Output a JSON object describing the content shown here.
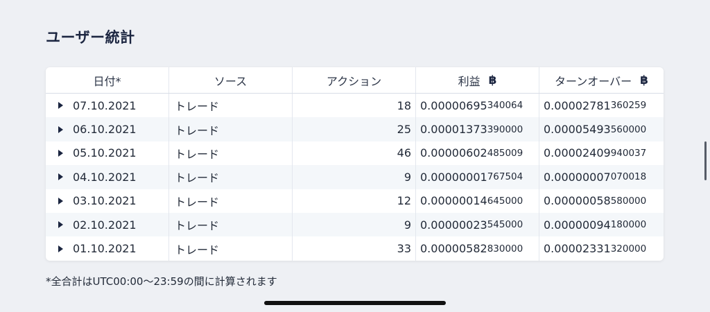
{
  "page_title": "ユーザー統計",
  "table": {
    "headers": {
      "date": "日付*",
      "source": "ソース",
      "action": "アクション",
      "profit": "利益",
      "turnover": "ターンオーバー"
    },
    "currency_symbol": "฿",
    "rows": [
      {
        "date": "07.10.2021",
        "source": "トレード",
        "action": "18",
        "profit_main": "0.00000695",
        "profit_tail": "340064",
        "turnover_main": "0.00002781",
        "turnover_tail": "360259"
      },
      {
        "date": "06.10.2021",
        "source": "トレード",
        "action": "25",
        "profit_main": "0.00001373",
        "profit_tail": "390000",
        "turnover_main": "0.00005493",
        "turnover_tail": "560000"
      },
      {
        "date": "05.10.2021",
        "source": "トレード",
        "action": "46",
        "profit_main": "0.00000602",
        "profit_tail": "485009",
        "turnover_main": "0.00002409",
        "turnover_tail": "940037"
      },
      {
        "date": "04.10.2021",
        "source": "トレード",
        "action": "9",
        "profit_main": "0.00000001",
        "profit_tail": "767504",
        "turnover_main": "0.00000007",
        "turnover_tail": "070018"
      },
      {
        "date": "03.10.2021",
        "source": "トレード",
        "action": "12",
        "profit_main": "0.00000014",
        "profit_tail": "645000",
        "turnover_main": "0.00000058",
        "turnover_tail": "580000"
      },
      {
        "date": "02.10.2021",
        "source": "トレード",
        "action": "9",
        "profit_main": "0.00000023",
        "profit_tail": "545000",
        "turnover_main": "0.00000094",
        "turnover_tail": "180000"
      },
      {
        "date": "01.10.2021",
        "source": "トレード",
        "action": "33",
        "profit_main": "0.00000582",
        "profit_tail": "830000",
        "turnover_main": "0.00002331",
        "turnover_tail": "320000"
      }
    ]
  },
  "footnote": "*全合計はUTC00:00〜23:59の間に計算されます"
}
